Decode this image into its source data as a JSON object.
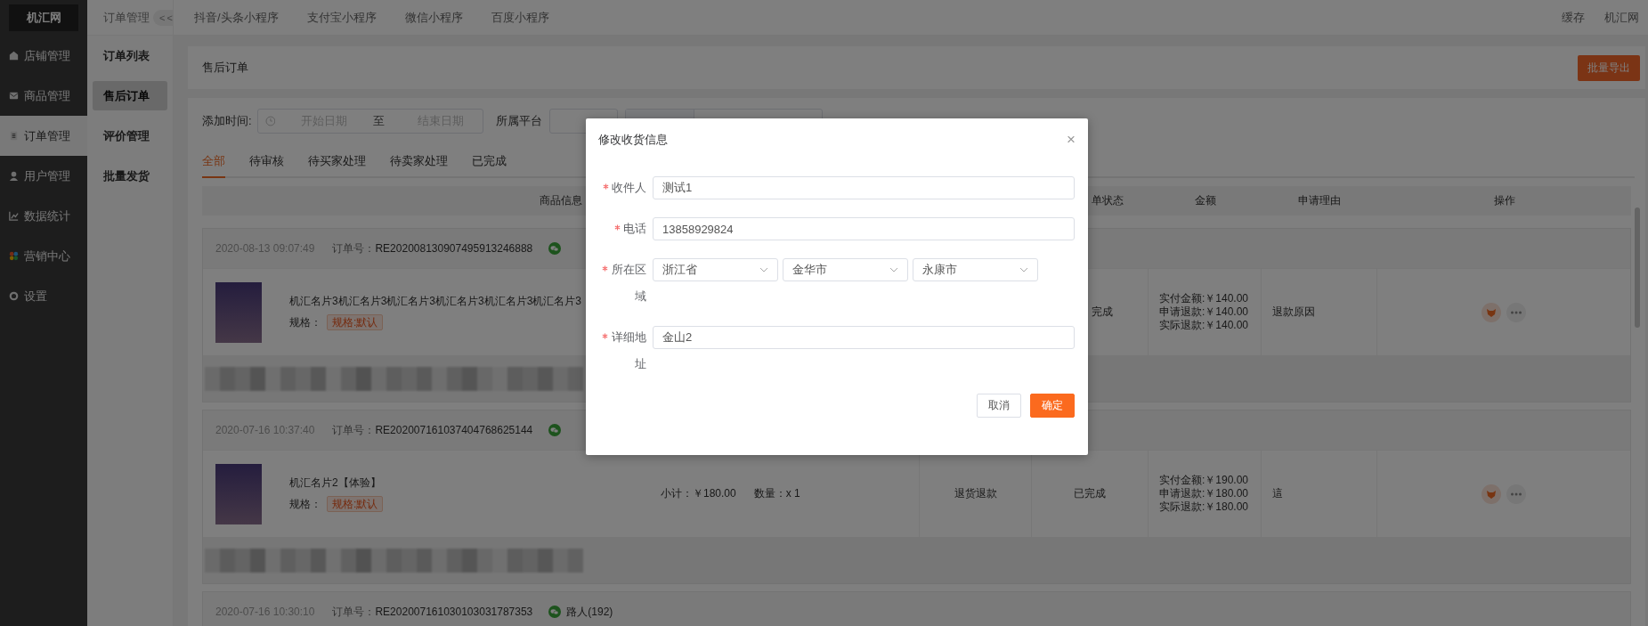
{
  "sidebar": {
    "logo": "机汇网",
    "items": [
      {
        "label": "店铺管理",
        "selected": false
      },
      {
        "label": "商品管理",
        "selected": false
      },
      {
        "label": "订单管理",
        "selected": true
      },
      {
        "label": "用户管理",
        "selected": false
      },
      {
        "label": "数据统计",
        "selected": false
      },
      {
        "label": "营销中心",
        "selected": false
      },
      {
        "label": "设置",
        "selected": false
      }
    ]
  },
  "subnav": {
    "title": "订单管理",
    "collapse": "<<",
    "items": [
      {
        "label": "订单列表",
        "selected": false
      },
      {
        "label": "售后订单",
        "selected": true
      },
      {
        "label": "评价管理",
        "selected": false
      },
      {
        "label": "批量发货",
        "selected": false
      }
    ]
  },
  "top_tabs": [
    "抖音/头条小程序",
    "支付宝小程序",
    "微信小程序",
    "百度小程序"
  ],
  "top_right": [
    "缓存",
    "机汇网"
  ],
  "page": {
    "title": "售后订单",
    "export_button": "批量导出"
  },
  "filters": {
    "date_label": "添加时间:",
    "start_placeholder": "开始日期",
    "separator": "至",
    "end_placeholder": "结束日期",
    "platform_label": "所属平台"
  },
  "status_tabs": [
    {
      "label": "全部",
      "selected": true
    },
    {
      "label": "待审核",
      "selected": false
    },
    {
      "label": "待买家处理",
      "selected": false
    },
    {
      "label": "待卖家处理",
      "selected": false
    },
    {
      "label": "已完成",
      "selected": false
    }
  ],
  "table": {
    "columns": [
      "商品信息",
      "单状态",
      "金额",
      "申请理由",
      "操作"
    ]
  },
  "orders": [
    {
      "time": "2020-08-13 09:07:49",
      "order_label": "订单号：",
      "order_no": "RE202008130907495913246888",
      "product": {
        "title": "机汇名片3机汇名片3机汇名片3机汇名片3机汇名片3机汇名片3",
        "spec_label": "规格：",
        "spec": "规格:默认"
      },
      "status": "完成",
      "amounts": [
        "实付金额:￥140.00",
        "申请退款:￥140.00",
        "实际退款:￥140.00"
      ],
      "reason": "退款原因"
    },
    {
      "time": "2020-07-16 10:37:40",
      "order_label": "订单号：",
      "order_no": "RE202007161037404768625144",
      "product": {
        "title": "机汇名片2【体验】",
        "spec_label": "规格：",
        "spec": "规格:默认",
        "subtotal": "小计：￥180.00",
        "quantity": "数量：x 1"
      },
      "type": "退货退款",
      "status": "已完成",
      "amounts": [
        "实付金额:￥190.00",
        "申请退款:￥180.00",
        "实际退款:￥180.00"
      ],
      "reason": "這"
    },
    {
      "time": "2020-07-16 10:30:10",
      "order_label": "订单号：",
      "order_no": "RE202007161030103031787353",
      "buyer": "路人(192)"
    }
  ],
  "modal": {
    "title": "修改收货信息",
    "close": "×",
    "fields": [
      {
        "kind": "input",
        "label": "收件人",
        "required": true,
        "value": "测试1"
      },
      {
        "kind": "input",
        "label": "电话",
        "required": true,
        "value": "13858929824"
      },
      {
        "kind": "region",
        "label": "所在区域",
        "required": true,
        "values": [
          "浙江省",
          "金华市",
          "永康市"
        ]
      },
      {
        "kind": "input",
        "label": "详细地址",
        "required": true,
        "value": "金山2"
      }
    ],
    "buttons": [
      {
        "label": "取消",
        "primary": false
      },
      {
        "label": "确定",
        "primary": true
      }
    ]
  }
}
